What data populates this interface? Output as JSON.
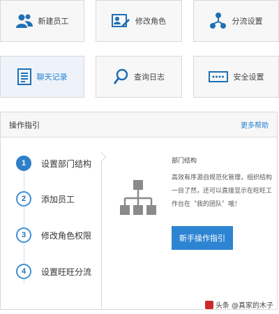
{
  "tiles": [
    {
      "label": "新建员工",
      "icon": "users-icon"
    },
    {
      "label": "修改角色",
      "icon": "edit-role-icon"
    },
    {
      "label": "分流设置",
      "icon": "distribution-icon"
    },
    {
      "label": "聊天记录",
      "icon": "chat-record-icon",
      "active": true
    },
    {
      "label": "查询日志",
      "icon": "search-icon"
    },
    {
      "label": "安全设置",
      "icon": "password-icon"
    }
  ],
  "panel": {
    "title": "操作指引",
    "more": "更多帮助"
  },
  "steps": [
    {
      "num": "1",
      "label": "设置部门结构",
      "active": true
    },
    {
      "num": "2",
      "label": "添加员工"
    },
    {
      "num": "3",
      "label": "修改角色权限"
    },
    {
      "num": "4",
      "label": "设置旺旺分流"
    }
  ],
  "detail": {
    "title": "部门结构",
    "description": "高效有序源自规范化管理，组织结构一目了然，还可以直接显示在旺旺工作台在〝我的团队〞哦！",
    "button": "新手操作指引"
  },
  "watermark": "头条 @真家的木子",
  "colors": {
    "accent": "#2d84d2",
    "active_step": "#2f7fc9",
    "icon_blue": "#1f6fb5"
  }
}
